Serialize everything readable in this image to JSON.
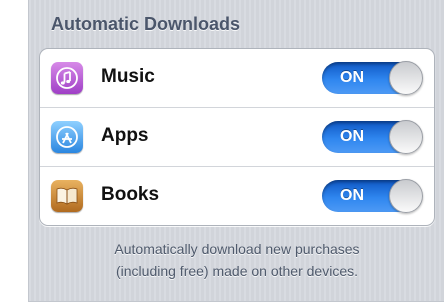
{
  "section": {
    "title": "Automatic Downloads"
  },
  "items": [
    {
      "label": "Music",
      "icon": "music-icon",
      "toggle": "ON"
    },
    {
      "label": "Apps",
      "icon": "app-store-icon",
      "toggle": "ON"
    },
    {
      "label": "Books",
      "icon": "books-icon",
      "toggle": "ON"
    }
  ],
  "footer": {
    "line1": "Automatically download new purchases",
    "line2": "(including free) made on other devices."
  },
  "colors": {
    "toggle_on": "#2f86ef",
    "background": "#d6d9df",
    "header_text": "#4b566b"
  }
}
